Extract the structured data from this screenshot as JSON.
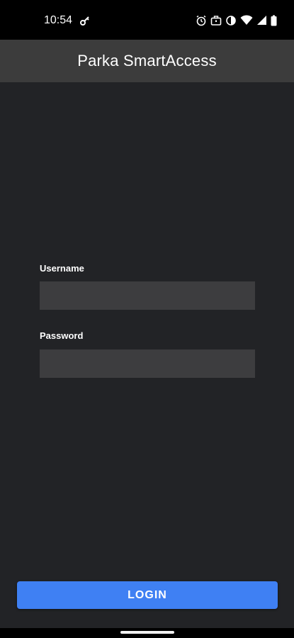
{
  "status_bar": {
    "time": "10:54",
    "left_icons": [
      "key-icon"
    ],
    "right_icons": [
      "alarm-icon",
      "work-profile-icon",
      "data-saver-icon",
      "wifi-icon",
      "cellular-signal-icon",
      "battery-icon"
    ]
  },
  "app_bar": {
    "title": "Parka SmartAccess"
  },
  "form": {
    "username_label": "Username",
    "username_value": "",
    "password_label": "Password",
    "password_value": ""
  },
  "login_button": {
    "label": "LOGIN"
  },
  "colors": {
    "app_bar_bg": "#3c3c3c",
    "content_bg": "#222326",
    "input_bg": "#3d3d3f",
    "accent": "#3f80f3"
  }
}
